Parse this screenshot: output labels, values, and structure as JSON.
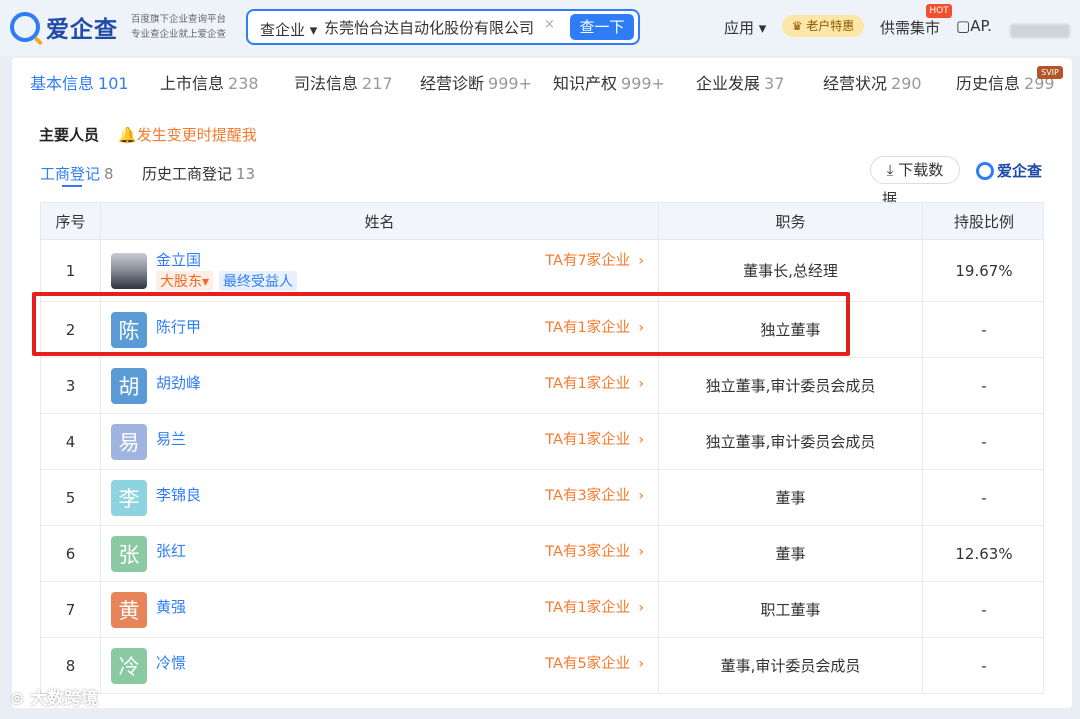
{
  "header": {
    "logo_text": "爱企查",
    "slogan_line1": "百度旗下企业查询平台",
    "slogan_line2": "专业查企业就上爱企查",
    "search_scope": "查企业",
    "search_value": "东莞怡合达自动化股份有限公司",
    "search_button": "查一下",
    "nav_app": "应用",
    "vip_label": "老户特惠",
    "supply_label": "供需集市",
    "hot_badge": "HOT",
    "user_label": "AP."
  },
  "tabs": [
    {
      "label": "基本信息",
      "count": "101"
    },
    {
      "label": "上市信息",
      "count": "238"
    },
    {
      "label": "司法信息",
      "count": "217"
    },
    {
      "label": "经营诊断",
      "count": "999+"
    },
    {
      "label": "知识产权",
      "count": "999+"
    },
    {
      "label": "企业发展",
      "count": "37"
    },
    {
      "label": "经营状况",
      "count": "290"
    },
    {
      "label": "历史信息",
      "count": "299"
    }
  ],
  "svip_badge": "SVIP",
  "section": {
    "title": "主要人员",
    "notify": "发生变更时提醒我",
    "subtabs": [
      {
        "label": "工商登记",
        "count": "8"
      },
      {
        "label": "历史工商登记",
        "count": "13"
      }
    ],
    "download_label": "下载数",
    "download_wrap": "据",
    "brand": "爱企查"
  },
  "table": {
    "headers": {
      "no": "序号",
      "name": "姓名",
      "position": "职务",
      "share": "持股比例"
    },
    "rows": [
      {
        "no": "1",
        "avatar": "",
        "name": "金立国",
        "ta": "TA有7家企业",
        "position": "董事长,总经理",
        "share": "19.67%",
        "tag_major": "大股东",
        "tag_benef": "最终受益人"
      },
      {
        "no": "2",
        "avatar": "陈",
        "name": "陈行甲",
        "ta": "TA有1家企业",
        "position": "独立董事",
        "share": "-"
      },
      {
        "no": "3",
        "avatar": "胡",
        "name": "胡劲峰",
        "ta": "TA有1家企业",
        "position": "独立董事,审计委员会成员",
        "share": "-"
      },
      {
        "no": "4",
        "avatar": "易",
        "name": "易兰",
        "ta": "TA有1家企业",
        "position": "独立董事,审计委员会成员",
        "share": "-"
      },
      {
        "no": "5",
        "avatar": "李",
        "name": "李锦良",
        "ta": "TA有3家企业",
        "position": "董事",
        "share": "-"
      },
      {
        "no": "6",
        "avatar": "张",
        "name": "张红",
        "ta": "TA有3家企业",
        "position": "董事",
        "share": "12.63%"
      },
      {
        "no": "7",
        "avatar": "黄",
        "name": "黄强",
        "ta": "TA有1家企业",
        "position": "职工董事",
        "share": "-"
      },
      {
        "no": "8",
        "avatar": "冷",
        "name": "冷憬",
        "ta": "TA有5家企业",
        "position": "董事,审计委员会成员",
        "share": "-"
      }
    ]
  },
  "colors": {
    "avatar_2": "#5b9bd5",
    "avatar_3": "#5b9bd5",
    "avatar_4": "#9fb4e0",
    "avatar_5": "#8dd3e0",
    "avatar_6": "#8bc9a3",
    "avatar_7": "#e8845a",
    "avatar_8": "#8bc9a3"
  },
  "watermark": "大数跨境"
}
